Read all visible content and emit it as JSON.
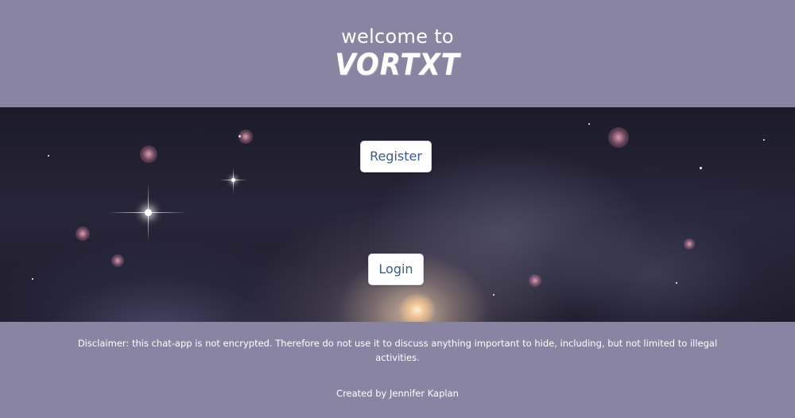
{
  "header": {
    "welcome_text": "welcome to",
    "brand_name": "VORTXT"
  },
  "banner": {
    "register_label": "Register",
    "login_label": "Login"
  },
  "footer": {
    "disclaimer": "Disclaimer: this chat-app is not encrypted. Therefore do not use it to discuss anything important to hide, including, but not limited to illegal activities.",
    "credit": "Created by Jennifer Kaplan"
  },
  "colors": {
    "page_background": "#8a84a3",
    "button_text": "#3a5a8c",
    "button_background": "#ffffff",
    "header_text": "#ffffff"
  }
}
